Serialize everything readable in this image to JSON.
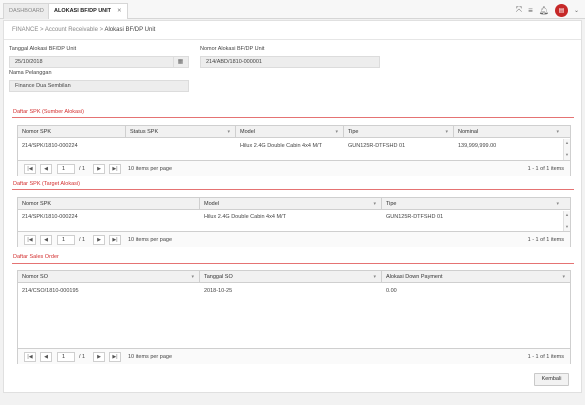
{
  "tabs": [
    {
      "label": "DASHBOARD"
    },
    {
      "label": "ALOKASI BF/DP UNIT"
    }
  ],
  "breadcrumb": {
    "root": "FINANCE",
    "mid": "Account Receivable",
    "current": "Alokasi BF/DP Unit",
    "sep": ">"
  },
  "form": {
    "tanggal_label": "Tanggal Alokasi BF/DP Unit",
    "tanggal_value": "25/10/2018",
    "nomor_label": "Nomor Alokasi BF/DP Unit",
    "nomor_value": "214/ABD/1810-000001",
    "pelanggan_label": "Nama Pelanggan",
    "pelanggan_value": "Finance Dua Sembilan"
  },
  "grid1": {
    "title": "Daftar SPK (Sumber Alokasi)",
    "columns": [
      "Nomor SPK",
      "Status SPK",
      "Model",
      "Tipe",
      "Nominal"
    ],
    "rows": [
      [
        "214/SPK/1810-000224",
        "",
        "Hilux 2.4G Double Cabin 4x4 M/T",
        "GUN125R-DTFSHD 01",
        "139,999,999.00"
      ]
    ],
    "page": "1",
    "page_of": "/ 1",
    "per_page": "10 items per page",
    "range": "1 - 1 of 1 items"
  },
  "grid2": {
    "title": "Daftar SPK (Target Alokasi)",
    "columns": [
      "Nomor SPK",
      "Model",
      "Tipe"
    ],
    "rows": [
      [
        "214/SPK/1810-000224",
        "Hilux 2.4G Double Cabin 4x4 M/T",
        "GUN125R-DTFSHD 01"
      ]
    ],
    "page": "1",
    "page_of": "/ 1",
    "per_page": "10 items per page",
    "range": "1 - 1 of 1 items"
  },
  "grid3": {
    "title": "Daftar Sales Order",
    "columns": [
      "Nomor SO",
      "Tanggal SO",
      "Alokasi Down Payment"
    ],
    "rows": [
      [
        "214/CSO/1810-000195",
        "2018-10-25",
        "0.00"
      ]
    ],
    "page": "1",
    "page_of": "/ 1",
    "per_page": "10 items per page",
    "range": "1 - 1 of 1 items"
  },
  "icons": {
    "close": "close-icon",
    "expand": "expand-icon",
    "menu": "menu-icon",
    "bell": "bell-icon",
    "calendar": "calendar-icon"
  },
  "pager": {
    "first": "|◀",
    "prev": "◀",
    "next": "▶",
    "last": "▶|"
  },
  "actions": {
    "back_label": "Kembali"
  },
  "colors": {
    "accent_red": "#d32f2f",
    "avatar_red": "#c62828"
  }
}
